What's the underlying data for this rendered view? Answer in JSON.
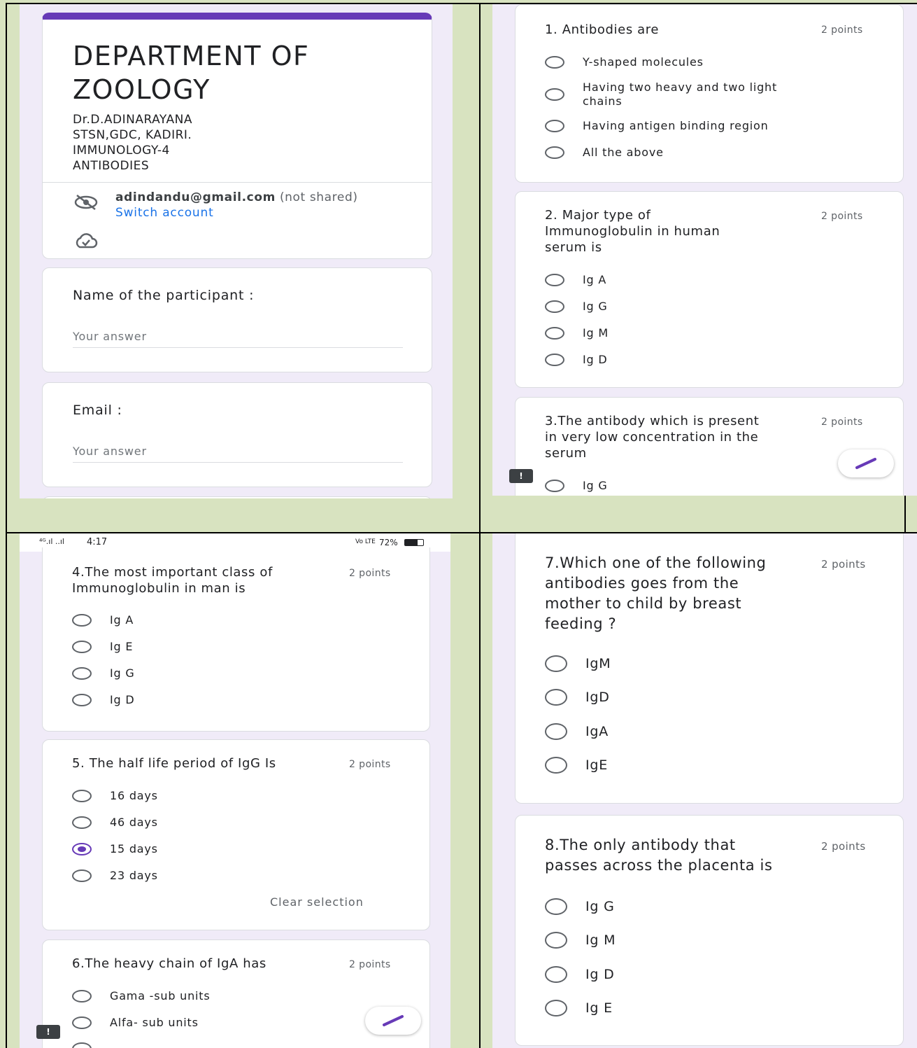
{
  "header": {
    "title": "DEPARTMENT OF ZOOLOGY",
    "title_line1": "DEPARTMENT OF",
    "title_line2": "ZOOLOGY",
    "desc1": "Dr.D.ADINARAYANA",
    "desc2": "STSN,GDC, KADIRI.",
    "desc3": "IMMUNOLOGY-4",
    "desc4": "ANTIBODIES",
    "email": "adindandu@gmail.com",
    "not_shared": "(not shared)",
    "switch_account": "Switch account"
  },
  "fields": [
    {
      "label": "Name of the participant :",
      "placeholder": "Your answer"
    },
    {
      "label": "Email :",
      "placeholder": "Your answer"
    }
  ],
  "status_bar": {
    "signal": "⁴ᴳ.ıl ..ıl",
    "time": "4:17",
    "network": "Vo LTE",
    "battery": "72%"
  },
  "colors": {
    "accent": "#673ab7",
    "link": "#1a73e8",
    "panel_bg": "#f0ebf8",
    "page_bg": "#d8e3c0"
  },
  "questions": [
    {
      "title_l1": "1. Antibodies are",
      "points": "2 points",
      "options": [
        "Y-shaped molecules",
        "Having two heavy and two light",
        "chains",
        "Having antigen binding region",
        "All the above"
      ]
    },
    {
      "title_l1": "2. Major type of",
      "title_l2": "Immunoglobulin in human",
      "title_l3": "serum is",
      "points": "2 points",
      "options": [
        "Ig A",
        "Ig G",
        "Ig M",
        "Ig D"
      ]
    },
    {
      "title_l1": "3.The antibody which is present",
      "title_l2": "in very low concentration in the",
      "title_l3": "serum",
      "points": "2 points",
      "options": [
        "Ig G"
      ]
    },
    {
      "title_l1": "4.The most important class of",
      "title_l2": "Immunoglobulin in man is",
      "points": "2 points",
      "options": [
        "Ig A",
        "Ig E",
        "Ig G",
        "Ig D"
      ]
    },
    {
      "title_l1": "5. The half life period of IgG  Is",
      "points": "2 points",
      "options": [
        "16 days",
        "46 days",
        "15 days",
        "23 days"
      ],
      "clear": "Clear selection"
    },
    {
      "title_l1": "6.The heavy chain of IgA has",
      "points": "2 points",
      "options": [
        "Gama -sub units",
        "Alfa- sub units"
      ]
    },
    {
      "title_l1": "7.Which one of the following",
      "title_l2": "antibodies goes from the",
      "title_l3": "mother to child by breast",
      "title_l4": "feeding ?",
      "points": "2 points",
      "options": [
        "IgM",
        "IgD",
        "IgA",
        "IgE"
      ]
    },
    {
      "title_l1": "8.The only antibody that",
      "title_l2": "passes across the placenta is",
      "points": "2 points",
      "options": [
        "Ig G",
        "Ig M",
        "Ig D",
        "Ig E"
      ]
    }
  ]
}
